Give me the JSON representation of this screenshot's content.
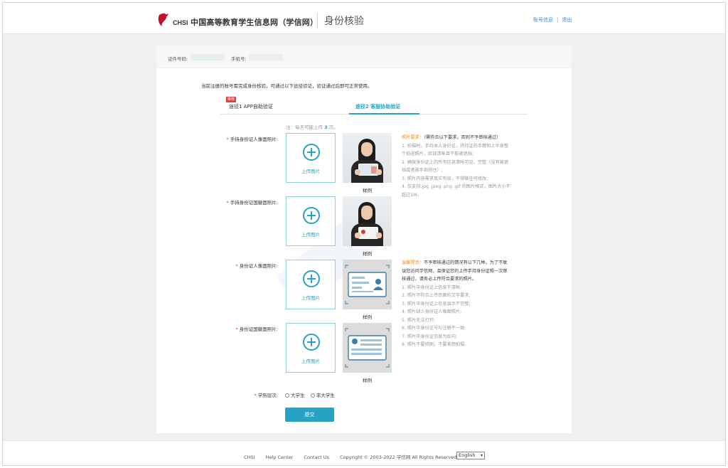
{
  "header": {
    "logo_text": "CHSI",
    "site_name": "中国高等教育学生信息网（学信网）",
    "page_title": "身份核验",
    "links": [
      "账号信息",
      "退出"
    ]
  },
  "info_bar": {
    "id_label": "证件号码:",
    "phone_label": "手机号:"
  },
  "notice": "当前注册的账号需完成身份核验，可通过以下途径验证，验证通过后即可正常使用。",
  "tabs": [
    {
      "label": "途径1 APP自助验证",
      "badge": "推荐"
    },
    {
      "label": "途径2 客服协助验证"
    }
  ],
  "note": {
    "prefix": "注：每天可能上传",
    "count": "3",
    "suffix": "次。"
  },
  "upload_label": "上传图片",
  "sample_label": "样例",
  "rows": [
    {
      "label": "手持身份证人像面照片:"
    },
    {
      "label": "手持身份证国徽面照片:"
    },
    {
      "label": "身份证人像面照片:"
    },
    {
      "label": "身份证国徽面照片:"
    }
  ],
  "photo_requirements": {
    "title": "照片要求：",
    "title_note": "（需符合以下要求，否则不予审核通过）",
    "lines": [
      "1. 拍摄时，手持本人身份证，将持证的手臂和上半身整",
      "个拍进照片，脸部清晰且不能被遮挡;",
      "2. 确保身份证上的所有信息清晰可见、完整（没有被遮",
      "挡或者被手指捏住）;",
      "3. 照片内容需求真实有效，不得做任何修改;",
      "4. 仅支持.jpg .jpeg .png .gif 的图片格式，图片大小不",
      "超过1M。"
    ]
  },
  "warm_tips": {
    "title": "温馨提示：",
    "intro_lines": [
      "不予审核通过的情况有以下几种，为了不耽",
      "误您访问学信网，且保证您的上传手持身份证照一次审",
      "核通过，请务必上传符合要求的照片。"
    ],
    "lines": [
      "1. 照片中身份证上信息不清晰;",
      "2. 照片不符合上传页面的文字要求;",
      "3. 照片中身份证上信息显示不完整;",
      "4. 照片缺少身份证人像面照片;",
      "5. 照片无法打开;",
      "6. 照片中身份证号与注册不一致;",
      "7. 照片中身份证信息为反向;",
      "8. 照片不要修图，不要美颜拍摄。"
    ]
  },
  "education": {
    "label": "学历层次:",
    "options": [
      "大学生",
      "非大学生"
    ]
  },
  "submit_label": "提交",
  "footer": {
    "links": [
      "CHSI",
      "Help Center",
      "Contact Us",
      "Copyright © 2003-2022 学信网 All Rights Reserved"
    ],
    "language": "English"
  },
  "colors": {
    "accent": "#26a2c4",
    "warning": "#f28a1e",
    "required": "#e23c3c",
    "link": "#3a86c8"
  }
}
